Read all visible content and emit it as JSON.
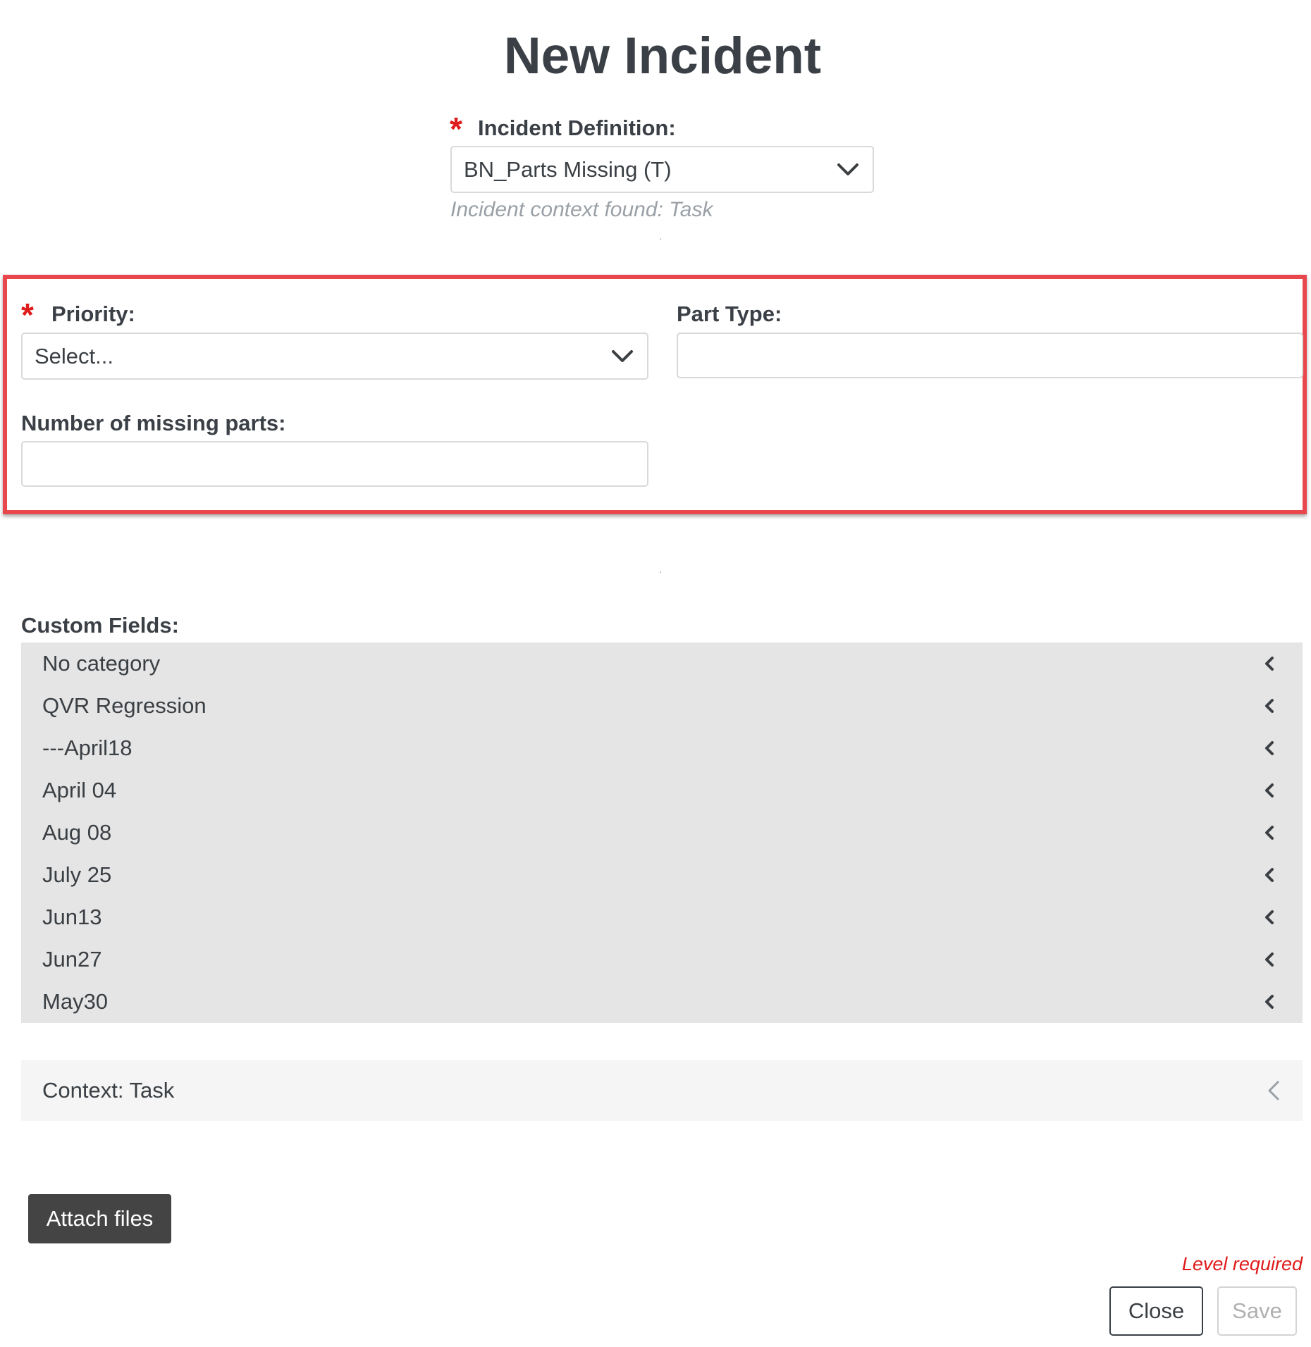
{
  "dialog": {
    "title": "New Incident"
  },
  "incident_definition": {
    "label": "Incident Definition:",
    "required_marker": "*",
    "selected_value": "BN_Parts Missing (T)",
    "hint": "Incident context found: Task",
    "chevron_icon": "chevron-down-icon"
  },
  "form": {
    "priority": {
      "label": "Priority:",
      "required_marker": "*",
      "selected_value": "Select...",
      "chevron_icon": "chevron-down-icon"
    },
    "part_type": {
      "label": "Part Type:",
      "value": ""
    },
    "missing_parts": {
      "label": "Number of missing parts:",
      "value": ""
    },
    "highlight_color": "#e8474d"
  },
  "separator": ".",
  "custom_fields": {
    "label": "Custom Fields:",
    "items": [
      {
        "label": "No category"
      },
      {
        "label": "QVR Regression"
      },
      {
        "label": "---April18"
      },
      {
        "label": "April 04"
      },
      {
        "label": "Aug 08"
      },
      {
        "label": "July 25"
      },
      {
        "label": "Jun13"
      },
      {
        "label": "Jun27"
      },
      {
        "label": "May30"
      }
    ],
    "item_icon": "chevron-left-icon"
  },
  "context_panel": {
    "label": "Context: Task",
    "icon": "chevron-left-icon"
  },
  "actions": {
    "attach_label": "Attach files",
    "validation_message": "Level required",
    "close_label": "Close",
    "save_label": "Save"
  }
}
